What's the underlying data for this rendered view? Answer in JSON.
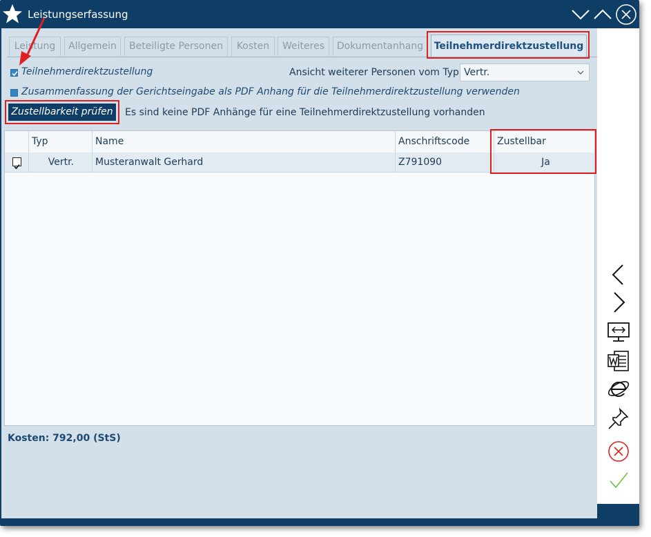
{
  "window": {
    "title": "Leistungserfassung",
    "app_icon": "star-icon",
    "controls": [
      "minimize-chevron-down-icon",
      "maximize-chevron-up-icon",
      "close-circle-icon"
    ]
  },
  "tabs": [
    {
      "label": "Leistung"
    },
    {
      "label": "Allgemein"
    },
    {
      "label": "Beteiligte Personen"
    },
    {
      "label": "Kosten"
    },
    {
      "label": "Weiteres"
    },
    {
      "label": "Dokumentanhang"
    },
    {
      "label": "Teilnehmerdirektzustellung",
      "active": true
    }
  ],
  "options": {
    "direct_delivery_label": "Teilnehmerdirektzustellung",
    "direct_delivery_checked": true,
    "view_type_label": "Ansicht weiterer Personen vom Typ",
    "view_type_value": "Vertr.",
    "summary_pdf_label": "Zusammenfassung der Gerichtseingabe als PDF Anhang für die Teilnehmerdirektzustellung verwenden",
    "summary_pdf_checked": false
  },
  "check": {
    "button_label": "Zustellbarkeit prüfen",
    "message": "Es sind keine PDF Anhänge für eine Teilnehmerdirektzustellung vorhanden"
  },
  "table": {
    "columns": [
      "",
      "Typ",
      "Name",
      "Anschriftscode",
      "Zustellbar"
    ],
    "rows": [
      {
        "checked": true,
        "typ": "Vertr.",
        "name": "Musteranwalt Gerhard",
        "code": "Z791090",
        "zustellbar": "Ja"
      }
    ]
  },
  "footer": {
    "costs": "Kosten: 792,00 (StS)"
  },
  "sidebar_icons": [
    "previous-chevron-icon",
    "next-chevron-icon",
    "monitor-resize-icon",
    "word-document-icon",
    "internet-explorer-icon",
    "pin-icon",
    "cancel-icon",
    "confirm-check-icon"
  ],
  "colors": {
    "titlebar": "#0e3e66",
    "panel": "#d3e0ea",
    "highlight": "#e02020",
    "cancel": "#e02020",
    "confirm": "#6cc04a"
  }
}
